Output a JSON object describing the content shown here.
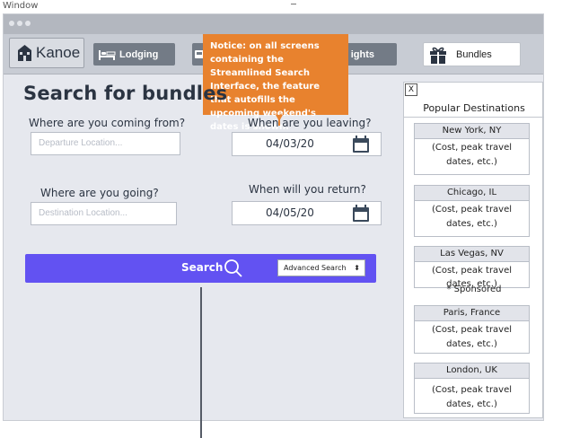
{
  "window_label": "Window",
  "nav": {
    "brand": "Kanoe",
    "lodging": "Lodging",
    "flights": "ights",
    "bundles": "Bundles"
  },
  "notice": "Notice: on all screens containing the Streamlined Search Interface, the feature that autofills the upcoming weekend's dates is shown.",
  "page_title": "Search for bundles",
  "form": {
    "from_label": "Where are you coming from?",
    "from_placeholder": "Departure Location...",
    "leave_label": "When are you leaving?",
    "leave_date": "04/03/20",
    "to_label": "Where are you going?",
    "to_placeholder": "Destination Location...",
    "return_label": "When will you return?",
    "return_date": "04/05/20"
  },
  "search": {
    "label": "Search",
    "advanced": "Advanced Search"
  },
  "panel": {
    "close": "X",
    "title": "Popular Destinations",
    "destinations": [
      {
        "name": "New York, NY",
        "body": "(Cost, peak travel dates, etc.)"
      },
      {
        "name": "Chicago, IL",
        "body": "(Cost, peak travel dates, etc.)"
      },
      {
        "name": "Las Vegas, NV",
        "body": "(Cost, peak travel dates, etc.)"
      },
      {
        "name": "Paris, France",
        "body": "(Cost, peak travel dates, etc.)"
      },
      {
        "name": "London, UK",
        "body": "(Cost, peak travel dates, etc.)"
      }
    ],
    "sponsored": "* Sponsored"
  },
  "colors": {
    "accent": "#6252f2",
    "notice": "#e8822e",
    "nav_button": "#737b86"
  }
}
